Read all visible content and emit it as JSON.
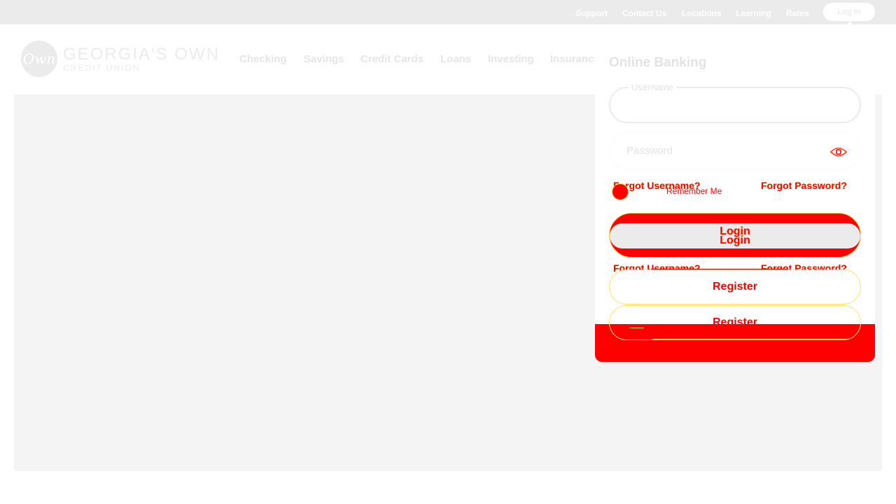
{
  "topbar": {
    "links": [
      "Support",
      "Contact Us",
      "Locations",
      "Learning",
      "Rates"
    ],
    "login_label": "Log In"
  },
  "brand": {
    "logo_mark": "Own",
    "name": "GEORGIA'S OWN",
    "sub": "CREDIT UNION"
  },
  "nav": {
    "items": [
      "Checking",
      "Savings",
      "Credit Cards",
      "Loans",
      "Investing",
      "Insurance"
    ]
  },
  "login_panel": {
    "title": "Online Banking",
    "username_label": "Username",
    "username_value": "",
    "password_placeholder": "Password",
    "forgot_username": "Forgot Username?",
    "forgot_password": "Forgot Password?",
    "remember_me": "Remember Me",
    "login_label": "Login",
    "register_label": "Register"
  },
  "icons": {
    "password_toggle": "eye-icon"
  },
  "colors": {
    "accent": "#ff0000",
    "outline": "#ffd84a",
    "muted": "#ebebeb",
    "hero": "#f4f4f4"
  }
}
